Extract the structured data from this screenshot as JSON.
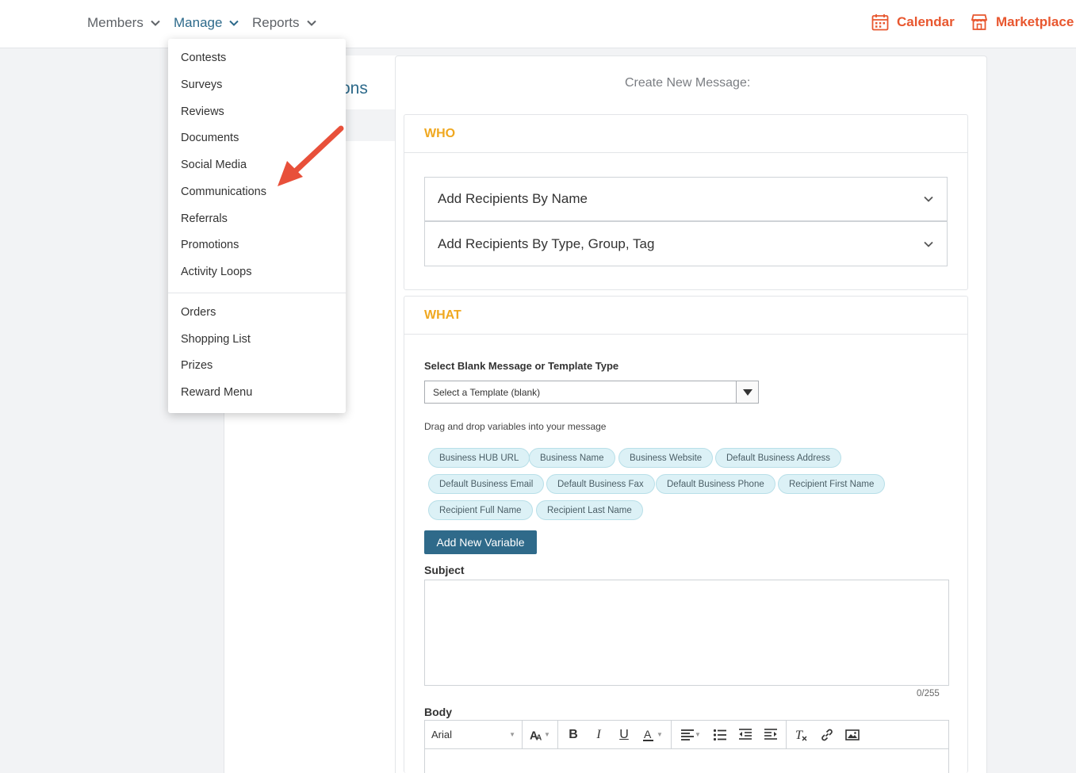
{
  "nav": {
    "members": "Members",
    "manage": "Manage",
    "reports": "Reports",
    "calendar": "Calendar",
    "marketplace": "Marketplace"
  },
  "page": {
    "title_partial": "ons",
    "create_title": "Create New Message:"
  },
  "who": {
    "heading": "WHO",
    "by_name": "Add Recipients By Name",
    "by_type": "Add Recipients By Type, Group, Tag"
  },
  "what": {
    "heading": "WHAT",
    "template_label": "Select Blank Message or Template Type",
    "template_value": "Select a Template (blank)",
    "drag_help": "Drag and drop variables into your message",
    "variables": [
      "Business HUB URL",
      "Business Name",
      "Business Website",
      "Default Business Address",
      "Default Business Email",
      "Default Business Fax",
      "Default Business Phone",
      "Recipient First Name",
      "Recipient Full Name",
      "Recipient Last Name"
    ],
    "add_variable": "Add New Variable",
    "subject_label": "Subject",
    "subject_counter": "0/255",
    "body_label": "Body",
    "font_value": "Arial"
  },
  "manage_menu": {
    "items": [
      "Contests",
      "Surveys",
      "Reviews",
      "Documents",
      "Social Media",
      "Communications",
      "Referrals",
      "Promotions",
      "Activity Loops",
      "Orders",
      "Shopping List",
      "Prizes",
      "Reward Menu"
    ]
  },
  "colors": {
    "accent_blue": "#2d6a8b",
    "section_heading": "#f0a820",
    "nav_orange": "#e8572f",
    "annotation_arrow": "#e8503a"
  }
}
